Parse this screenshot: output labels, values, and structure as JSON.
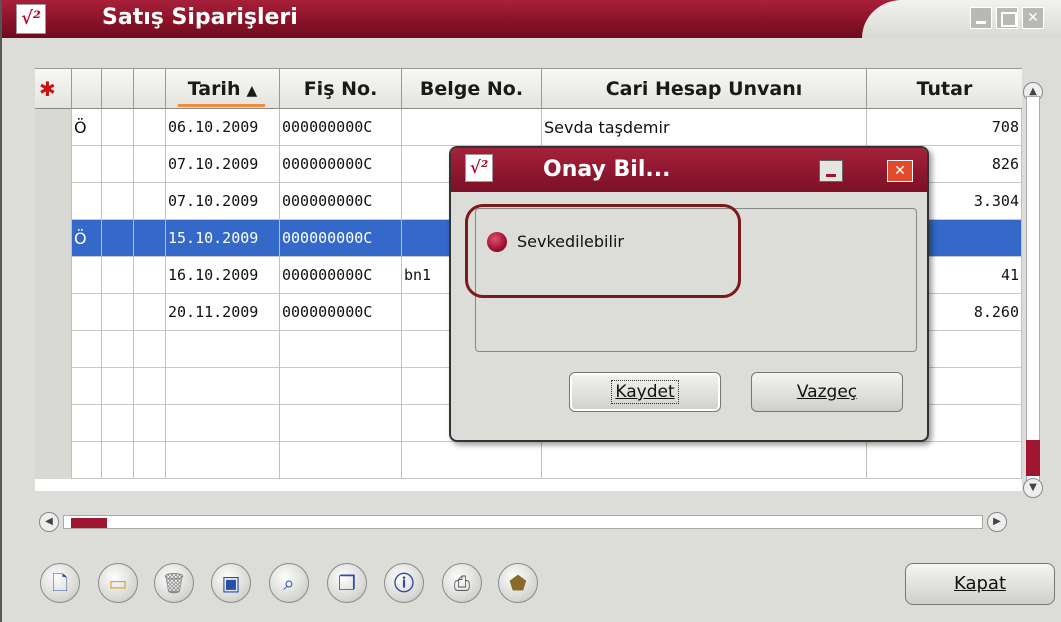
{
  "window": {
    "title": "Satış Siparişleri",
    "logo_glyph": "√²"
  },
  "grid": {
    "columns": [
      {
        "key": "icon",
        "label": ""
      },
      {
        "key": "c1",
        "label": ""
      },
      {
        "key": "c2",
        "label": ""
      },
      {
        "key": "c3",
        "label": ""
      },
      {
        "key": "tarih",
        "label": "Tarih"
      },
      {
        "key": "fis_no",
        "label": "Fiş No."
      },
      {
        "key": "belge_no",
        "label": "Belge No."
      },
      {
        "key": "cari",
        "label": "Cari Hesap Unvanı"
      },
      {
        "key": "tutar",
        "label": "Tutar"
      }
    ],
    "sort_indicator": "▲",
    "rows": [
      {
        "c1": "Ö",
        "tarih": "06.10.2009",
        "fis_no": "000000000C",
        "belge_no": "",
        "cari": "Sevda taşdemir",
        "tutar": "708"
      },
      {
        "c1": "",
        "tarih": "07.10.2009",
        "fis_no": "000000000C",
        "belge_no": "",
        "cari": "",
        "tutar": "826"
      },
      {
        "c1": "",
        "tarih": "07.10.2009",
        "fis_no": "000000000C",
        "belge_no": "",
        "cari": "",
        "tutar": "3.304"
      },
      {
        "c1": "Ö",
        "tarih": "15.10.2009",
        "fis_no": "000000000C",
        "belge_no": "",
        "cari": "",
        "tutar": "",
        "selected": true
      },
      {
        "c1": "",
        "tarih": "16.10.2009",
        "fis_no": "000000000C",
        "belge_no": "bn1",
        "cari": "",
        "tutar": "41"
      },
      {
        "c1": "",
        "tarih": "20.11.2009",
        "fis_no": "000000000C",
        "belge_no": "",
        "cari": "",
        "tutar": "8.260"
      },
      {
        "c1": "",
        "tarih": "",
        "fis_no": "",
        "belge_no": "",
        "cari": "",
        "tutar": ""
      },
      {
        "c1": "",
        "tarih": "",
        "fis_no": "",
        "belge_no": "",
        "cari": "",
        "tutar": ""
      },
      {
        "c1": "",
        "tarih": "",
        "fis_no": "",
        "belge_no": "",
        "cari": "",
        "tutar": ""
      },
      {
        "c1": "",
        "tarih": "",
        "fis_no": "",
        "belge_no": "",
        "cari": "",
        "tutar": ""
      }
    ]
  },
  "toolbar": {
    "icons": [
      "new-icon",
      "open-icon",
      "delete-icon",
      "preview-icon",
      "search-icon",
      "copy-icon",
      "info-icon",
      "print-icon",
      "print-setup-icon",
      "export-icon"
    ],
    "close_label": "Kapat"
  },
  "dialog": {
    "title": "Onay Bil...",
    "option_label": "Sevkedilebilir",
    "save_label": "Kaydet",
    "cancel_label": "Vazgeç"
  },
  "colors": {
    "accent": "#8a1228",
    "selection": "#3469c9",
    "sort_underline": "#f08c3c"
  }
}
